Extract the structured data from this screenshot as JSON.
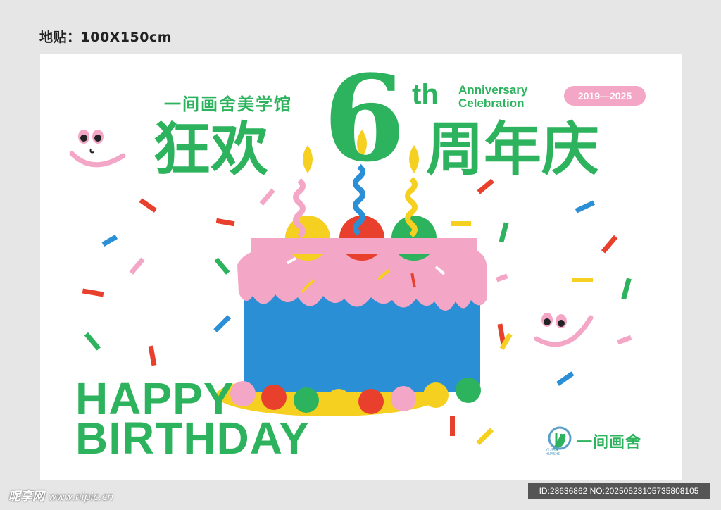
{
  "spec_label": "地贴：100X150cm",
  "poster": {
    "brand_name": "一间画舍美学馆",
    "title_left": "狂欢",
    "title_number": "6",
    "title_suffix": "th",
    "anniversary_line1": "Anniversary",
    "anniversary_line2": "Celebration",
    "title_right": "周年庆",
    "years_badge": "2019—2025",
    "happy": "HAPPY",
    "birthday": "BIRTHDAY",
    "logo_text": "一间画舍",
    "logo_sub_line1": "YI JIAN",
    "logo_sub_line2": "HUASHE"
  },
  "colors": {
    "green": "#2db35d",
    "pink": "#f4a6c6",
    "blue": "#2b8fd6",
    "yellow": "#f5d020",
    "red": "#e8402c"
  },
  "icons": [
    "smiley-face-icon",
    "birthday-cake-icon",
    "candle-icon",
    "confetti-icon",
    "brand-logo-icon"
  ],
  "watermark": {
    "site_name": "昵享网",
    "site_url": "www.nipic.cn",
    "id_text": "ID:28636862 NO:20250523105735808105"
  }
}
